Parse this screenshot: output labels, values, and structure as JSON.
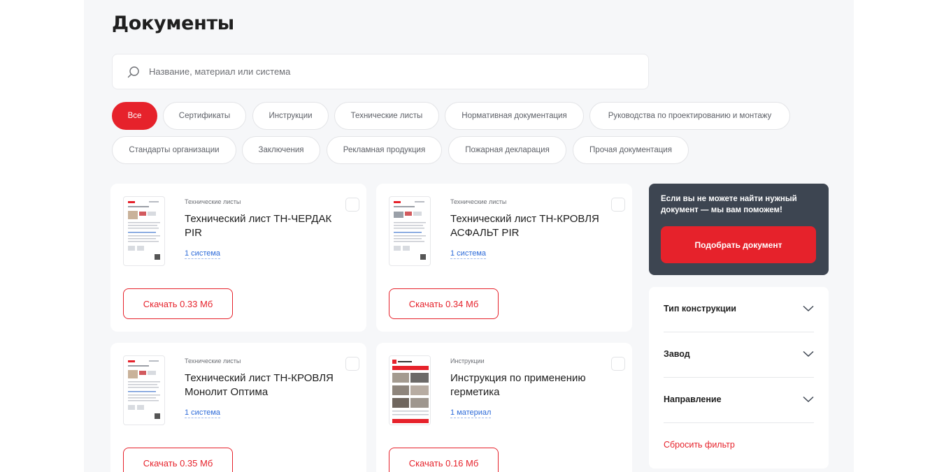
{
  "page": {
    "title": "Документы"
  },
  "search": {
    "placeholder": "Название, материал или система"
  },
  "filters_tabs": [
    {
      "label": "Все",
      "active": true
    },
    {
      "label": "Сертификаты",
      "active": false
    },
    {
      "label": "Инструкции",
      "active": false
    },
    {
      "label": "Технические листы",
      "active": false
    },
    {
      "label": "Нормативная документация",
      "active": false
    },
    {
      "label": "Руководства по проектированию и монтажу",
      "active": false
    },
    {
      "label": "Стандарты организации",
      "active": false
    },
    {
      "label": "Заключения",
      "active": false
    },
    {
      "label": "Рекламная продукция",
      "active": false
    },
    {
      "label": "Пожарная декларация",
      "active": false
    },
    {
      "label": "Прочая документация",
      "active": false
    }
  ],
  "cards": [
    {
      "category": "Технические листы",
      "title": "Технический лист ТН-ЧЕРДАК PIR",
      "link": "1 система",
      "download": "Скачать 0.33 Мб",
      "thumb": "document-thumbnail-icon"
    },
    {
      "category": "Технические листы",
      "title": "Технический лист ТН-КРОВЛЯ АСФАЛЬТ PIR",
      "link": "1 система",
      "download": "Скачать 0.34 Мб",
      "thumb": "document-thumbnail-icon"
    },
    {
      "category": "Технические листы",
      "title": "Технический лист ТН-КРОВЛЯ Монолит Оптима",
      "link": "1 система",
      "download": "Скачать 0.35 Мб",
      "thumb": "document-thumbnail-icon"
    },
    {
      "category": "Инструкции",
      "title": "Инструкция по применению герметика",
      "link": "1 материал",
      "download": "Скачать 0.16 Мб",
      "thumb": "instruction-thumbnail-icon"
    }
  ],
  "help": {
    "text": "Если вы не можете найти нужный документ — мы вам поможем!",
    "button": "Подобрать документ"
  },
  "sidebar_filters": {
    "items": [
      {
        "label": "Тип конструкции"
      },
      {
        "label": "Завод"
      },
      {
        "label": "Направление"
      }
    ],
    "reset": "Сбросить фильтр"
  },
  "colors": {
    "accent": "#e6222b",
    "dark_panel": "#3d4551",
    "link": "#2d6bd9",
    "background": "#f6f7f9"
  },
  "icons": {
    "search": "search-icon",
    "chevron": "chevron-down-icon",
    "checkbox": "checkbox-icon"
  }
}
